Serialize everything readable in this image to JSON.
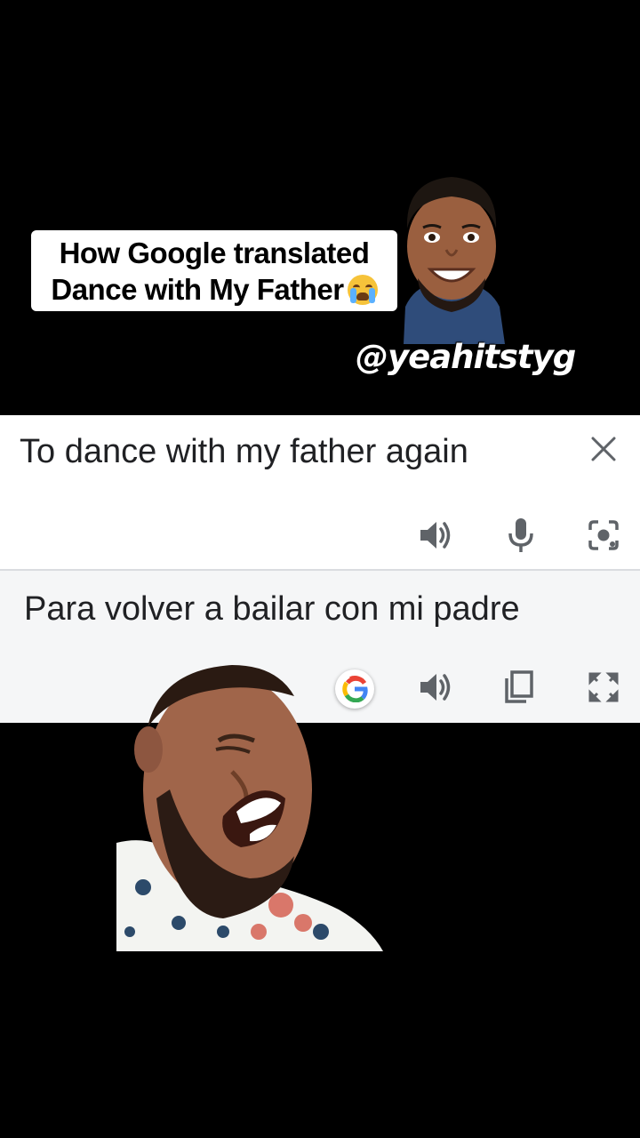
{
  "overlay": {
    "caption_line1": "How Google translated",
    "caption_line2": "Dance with My Father",
    "caption_emoji": "loudly-crying-face",
    "handle": "@yeahitstyg"
  },
  "translate": {
    "source_text": "To dance with my father again",
    "translated_text": "Para volver a bailar con mi padre",
    "source_icons": [
      "close-icon",
      "speaker-icon",
      "microphone-icon",
      "camera-lens-icon"
    ],
    "target_icons": [
      "google-logo-icon",
      "speaker-icon",
      "copy-icon",
      "fullscreen-icon"
    ]
  },
  "colors": {
    "background": "#000000",
    "text": "#202124",
    "icon": "#5f6368",
    "target_pane": "#f5f6f7"
  }
}
